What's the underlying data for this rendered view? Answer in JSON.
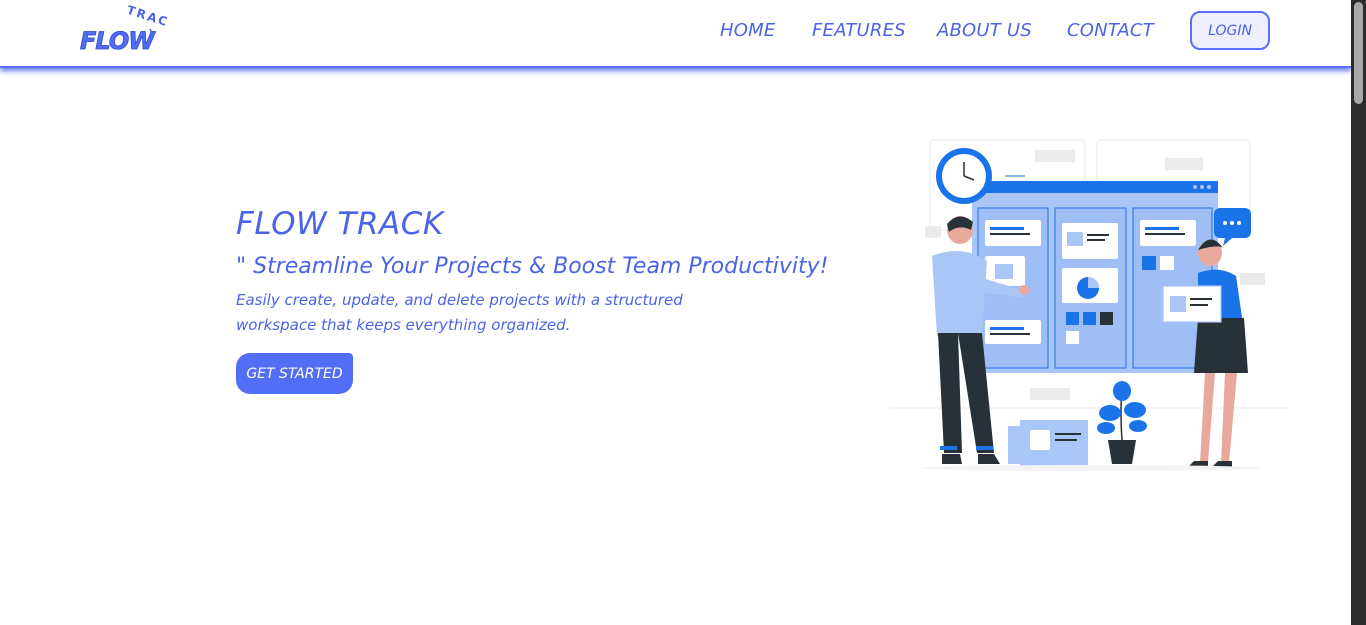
{
  "brand": {
    "logo_top": "TRACK",
    "logo_main": "FLOW"
  },
  "nav": {
    "items": [
      {
        "label": "HOME"
      },
      {
        "label": "FEATURES"
      },
      {
        "label": "ABOUT US"
      },
      {
        "label": "CONTACT"
      }
    ],
    "login_label": "LOGIN"
  },
  "hero": {
    "title": "FLOW TRACK",
    "subtitle": "\" Streamline Your Projects & Boost Team Productivity!",
    "description": "Easily create, update, and delete projects with a structured workspace that keeps everything organized.",
    "cta_label": "GET STARTED"
  },
  "colors": {
    "accent": "#536ef6",
    "text": "#4b63e8",
    "illustration_blue": "#1a73e8",
    "illustration_light": "#a9c6f7"
  },
  "icons": {
    "illustration": "team-kanban-board-illustration",
    "logo": "flowtrack-logo"
  }
}
